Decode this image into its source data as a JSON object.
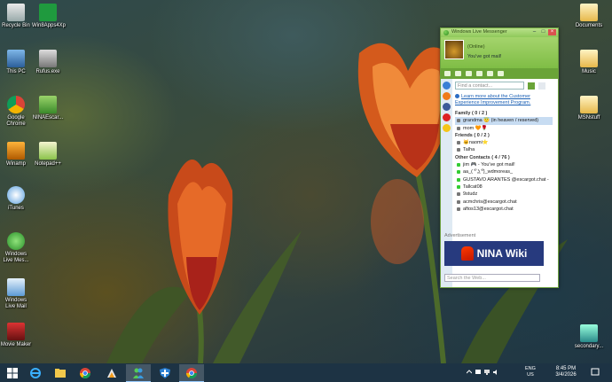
{
  "desktop": {
    "icons_left": [
      {
        "label": "Recycle Bin",
        "icon": "recycle-bin-icon"
      },
      {
        "label": "Win8Apps4Xp",
        "icon": "win8apps-icon"
      },
      {
        "label": "This PC",
        "icon": "computer-icon"
      },
      {
        "label": "Rufus.exe",
        "icon": "usb-drive-icon"
      },
      {
        "label": "Google Chrome",
        "icon": "chrome-icon"
      },
      {
        "label": "NINAEscar...",
        "icon": "nina-escargot-icon"
      },
      {
        "label": "Winamp",
        "icon": "winamp-icon"
      },
      {
        "label": "Notepad++",
        "icon": "notepadpp-icon"
      },
      {
        "label": "iTunes",
        "icon": "itunes-icon"
      },
      {
        "label": "Windows Live Mes...",
        "icon": "windows-live-messenger-icon"
      },
      {
        "label": "Windows Live Mail",
        "icon": "windows-live-mail-icon"
      },
      {
        "label": "Movie Maker",
        "icon": "movie-maker-icon"
      }
    ],
    "icons_right": [
      {
        "label": "Documents",
        "icon": "folder-documents-icon"
      },
      {
        "label": "Music",
        "icon": "folder-music-icon"
      },
      {
        "label": "MSNstuff",
        "icon": "folder-icon"
      },
      {
        "label": "secondary...",
        "icon": "drive-icon"
      }
    ]
  },
  "messenger": {
    "title": "Windows Live Messenger",
    "status": "(Online)",
    "personal_message": "You've got mail!",
    "search_placeholder": "Find a contact...",
    "notice": "Learn more about the Customer Experience Improvement Program.",
    "groups": [
      {
        "name": "Family ( 0 / 2 )",
        "contacts": [
          "grandma 😇 (in heaven / reserved)",
          "mom 🧡🌹"
        ]
      },
      {
        "name": "Friends ( 0 / 2 )",
        "contacts": [
          "🐱naomi⭐",
          "Talha"
        ]
      },
      {
        "name": "Other Contacts ( 4 / 76 )",
        "contacts": [
          "jim 🎮 - You've got mail!",
          "aa_( ͡° ͜ʖ ͡°)_wdmoreas_",
          "GUSTAVO ARANTES @escargot.chat -",
          "Tallcat08",
          "9studz",
          "acmchris@escargot.chat",
          "aftos13@escargot.chat"
        ]
      }
    ],
    "ad_label": "Advertisement",
    "ad_text": "NINA Wiki",
    "web_search_placeholder": "Search the Web..."
  },
  "taskbar": {
    "apps": [
      "start-icon",
      "internet-explorer-icon",
      "file-explorer-icon",
      "chrome-icon",
      "winamp-icon",
      "messenger-icon",
      "defender-icon",
      "chrome-icon"
    ],
    "language": "ENG",
    "region": "US",
    "time": "8:45 PM",
    "date": "3/4/2026"
  }
}
